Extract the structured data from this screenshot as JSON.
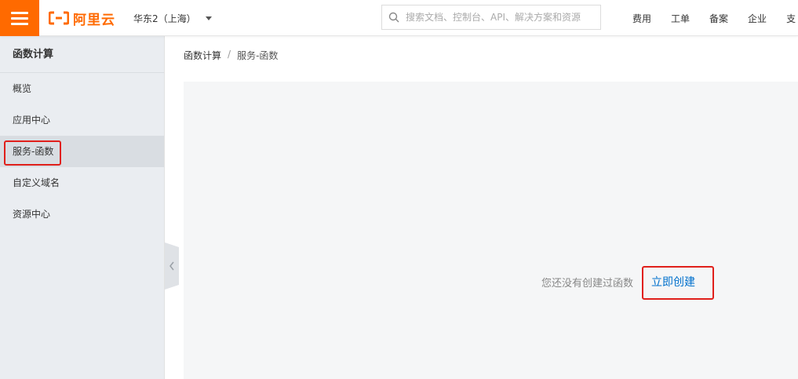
{
  "brand": {
    "name": "阿里云",
    "color": "#ff6a00"
  },
  "header": {
    "region": "华东2（上海）",
    "search": {
      "placeholder": "搜索文档、控制台、API、解决方案和资源",
      "value": ""
    },
    "nav": [
      "费用",
      "工单",
      "备案",
      "企业",
      "支"
    ]
  },
  "sidebar": {
    "title": "函数计算",
    "items": [
      {
        "label": "概览"
      },
      {
        "label": "应用中心"
      },
      {
        "label": "服务-函数",
        "active": true
      },
      {
        "label": "自定义域名"
      },
      {
        "label": "资源中心"
      }
    ]
  },
  "breadcrumb": [
    "函数计算",
    "/",
    "服务-函数"
  ],
  "main": {
    "empty_message": "您还没有创建过函数",
    "create_link": "立即创建"
  },
  "colors": {
    "accent": "#ff6a00",
    "link": "#0070cc",
    "highlight": "#e0201b"
  },
  "icons": [
    "menu-icon",
    "search-icon",
    "dropdown-caret-icon",
    "collapse-chevron-icon"
  ]
}
